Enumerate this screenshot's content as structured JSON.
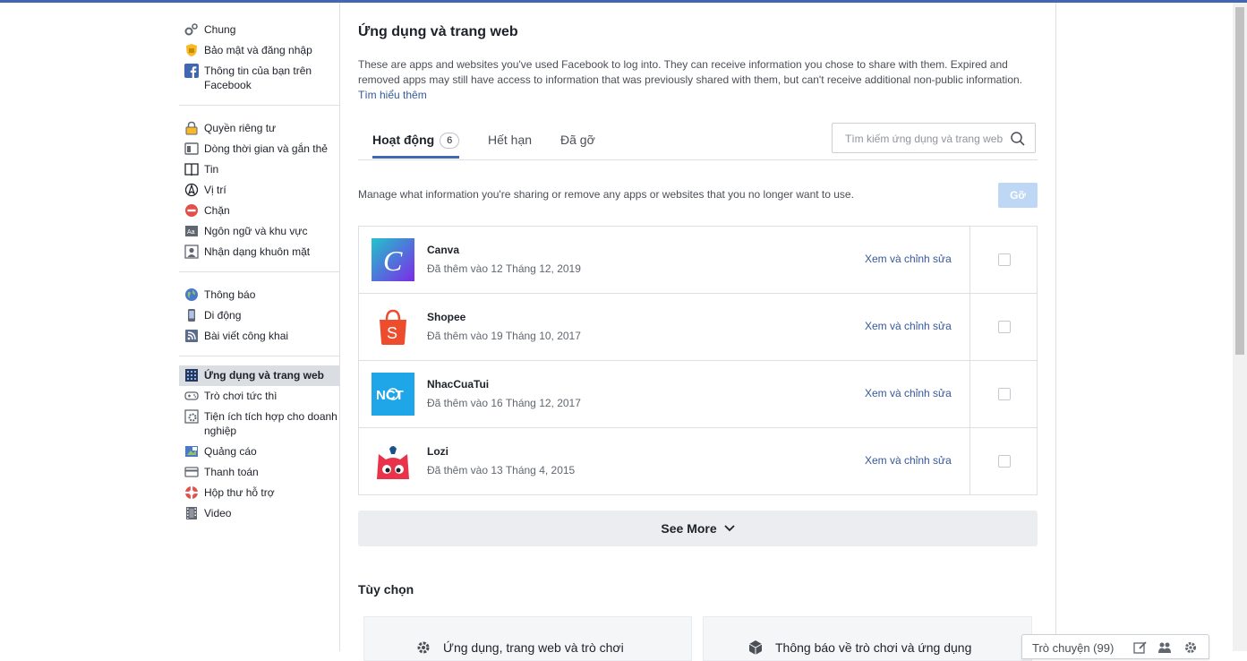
{
  "sidebar": {
    "groups": [
      {
        "items": [
          {
            "label": "Chung",
            "icon": "gears-icon"
          },
          {
            "label": "Bảo mật và đăng nhập",
            "icon": "shield-icon"
          },
          {
            "label": "Thông tin của bạn trên Facebook",
            "icon": "facebook-icon"
          }
        ]
      },
      {
        "items": [
          {
            "label": "Quyền riêng tư",
            "icon": "lock-icon"
          },
          {
            "label": "Dòng thời gian và gắn thẻ",
            "icon": "timeline-icon"
          },
          {
            "label": "Tin",
            "icon": "book-icon"
          },
          {
            "label": "Vị trí",
            "icon": "location-icon"
          },
          {
            "label": "Chặn",
            "icon": "block-icon"
          },
          {
            "label": "Ngôn ngữ và khu vực",
            "icon": "language-icon"
          },
          {
            "label": "Nhận dạng khuôn mặt",
            "icon": "face-icon"
          }
        ]
      },
      {
        "items": [
          {
            "label": "Thông báo",
            "icon": "globe-icon"
          },
          {
            "label": "Di động",
            "icon": "mobile-icon"
          },
          {
            "label": "Bài viết công khai",
            "icon": "rss-icon"
          }
        ]
      },
      {
        "items": [
          {
            "label": "Ứng dụng và trang web",
            "icon": "apps-icon",
            "active": true
          },
          {
            "label": "Trò chơi tức thì",
            "icon": "gamepad-icon"
          },
          {
            "label": "Tiện ích tích hợp cho doanh nghiệp",
            "icon": "gear-box-icon"
          },
          {
            "label": "Quảng cáo",
            "icon": "ads-icon"
          },
          {
            "label": "Thanh toán",
            "icon": "card-icon"
          },
          {
            "label": "Hộp thư hỗ trợ",
            "icon": "lifebuoy-icon"
          },
          {
            "label": "Video",
            "icon": "film-icon"
          }
        ]
      }
    ]
  },
  "main": {
    "title": "Ứng dụng và trang web",
    "description": "These are apps and websites you've used Facebook to log into. They can receive information you chose to share with them. Expired and removed apps may still have access to information that was previously shared with them, but can't receive additional non-public information.",
    "learn_more": "Tìm hiểu thêm",
    "tabs": [
      {
        "label": "Hoạt động",
        "count": "6",
        "active": true
      },
      {
        "label": "Hết hạn"
      },
      {
        "label": "Đã gỡ"
      }
    ],
    "search_placeholder": "Tìm kiếm ứng dụng và trang web",
    "manage_text": "Manage what information you're sharing or remove any apps or websites that you no longer want to use.",
    "remove_button": "Gỡ",
    "apps": [
      {
        "name": "Canva",
        "date": "Đã thêm vào 12 Tháng 12, 2019",
        "edit": "Xem và chỉnh sửa",
        "logo": "canva-logo"
      },
      {
        "name": "Shopee",
        "date": "Đã thêm vào 19 Tháng 10, 2017",
        "edit": "Xem và chỉnh sửa",
        "logo": "shopee-logo"
      },
      {
        "name": "NhacCuaTui",
        "date": "Đã thêm vào 16 Tháng 12, 2017",
        "edit": "Xem và chỉnh sửa",
        "logo": "nhaccuatui-logo"
      },
      {
        "name": "Lozi",
        "date": "Đã thêm vào 13 Tháng 4, 2015",
        "edit": "Xem và chỉnh sửa",
        "logo": "lozi-logo"
      }
    ],
    "see_more": "See More",
    "options_title": "Tùy chọn",
    "option_cards": [
      {
        "label": "Ứng dụng, trang web và trò chơi"
      },
      {
        "label": "Thông báo về trò chơi và ứng dụng"
      }
    ]
  },
  "chat": {
    "label": "Trò chuyện (99)"
  },
  "colors": {
    "brand": "#4267b2",
    "link": "#365899",
    "remove_disabled": "#bdd7f5"
  }
}
